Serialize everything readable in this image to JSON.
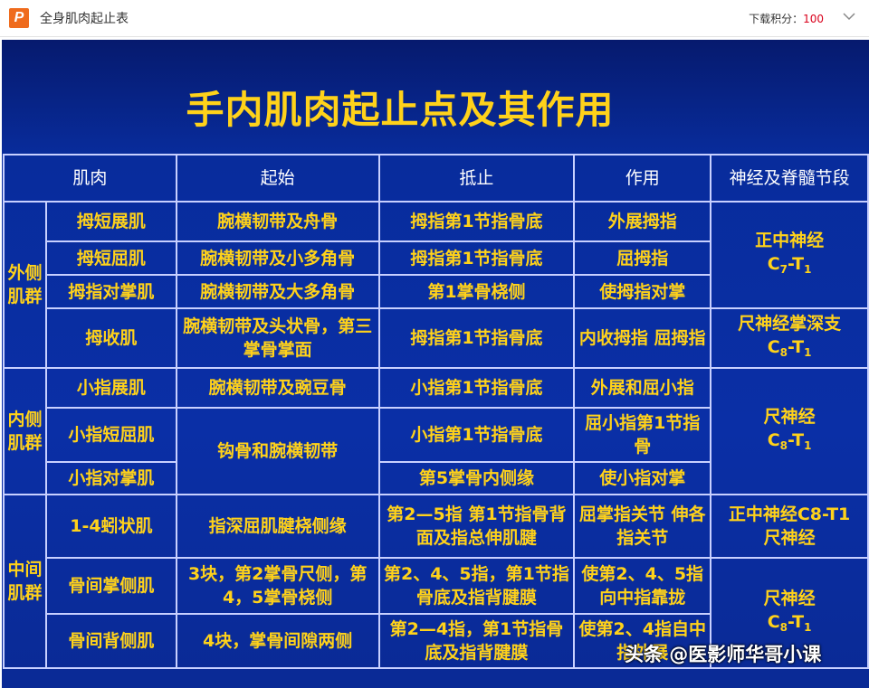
{
  "topbar": {
    "title": "全身肌肉起止表",
    "score_label": "下载积分：",
    "score_value": "100"
  },
  "slide": {
    "title": "手内肌肉起止点及其作用",
    "headers": [
      "肌肉",
      "起始",
      "抵止",
      "作用",
      "神经及脊髓节段"
    ],
    "groups": {
      "lateral": "外侧肌群",
      "medial": "内侧肌群",
      "middle": "中间肌群"
    },
    "rows": [
      {
        "muscle": "拇短展肌",
        "origin": "腕横韧带及舟骨",
        "insertion": "拇指第1节指骨底",
        "action": "外展拇指"
      },
      {
        "muscle": "拇短屈肌",
        "origin": "腕横韧带及小多角骨",
        "insertion": "拇指第1节指骨底",
        "action": "屈拇指"
      },
      {
        "muscle": "拇指对掌肌",
        "origin": "腕横韧带及大多角骨",
        "insertion": "第1掌骨桡侧",
        "action": "使拇指对掌"
      },
      {
        "muscle": "拇收肌",
        "origin": "腕横韧带及头状骨，第三掌骨掌面",
        "insertion": "拇指第1节指骨底",
        "action": "内收拇指 屈拇指"
      },
      {
        "muscle": "小指展肌",
        "origin": "腕横韧带及豌豆骨",
        "insertion": "小指第1节指骨底",
        "action": "外展和屈小指"
      },
      {
        "muscle": "小指短屈肌",
        "origin": "钩骨和腕横韧带",
        "insertion": "小指第1节指骨底",
        "action": "屈小指第1节指骨"
      },
      {
        "muscle": "小指对掌肌",
        "insertion": "第5掌骨内侧缘",
        "action": "使小指对掌"
      },
      {
        "muscle": "1-4蚓状肌",
        "origin": "指深屈肌腱桡侧缘",
        "insertion": "第2—5指 第1节指骨背面及指总伸肌腱",
        "action": "屈掌指关节 伸各指关节"
      },
      {
        "muscle": "骨间掌侧肌",
        "origin": "3块，第2掌骨尺侧，第4，5掌骨桡侧",
        "insertion": "第2、4、5指，第1节指骨底及指背腱膜",
        "action": "使第2、4、5指向中指靠拢"
      },
      {
        "muscle": "骨间背侧肌",
        "origin": "4块，掌骨间隙两侧",
        "insertion": "第2—4指，第1节指骨底及指背腱膜",
        "action": "使第2、4指自中指外展"
      }
    ],
    "nerves": {
      "median_1": "正中神经",
      "median_1_seg": "C7-T1",
      "ulnar_deep": "尺神经掌深支",
      "ulnar_deep_seg": "C8-T1",
      "ulnar_1": "尺神经",
      "ulnar_1_seg": "C8-T1",
      "mixed": "正中神经C8-T1",
      "mixed_2": "尺神经",
      "ulnar_2": "尺神经",
      "ulnar_2_seg": "C8-T1"
    }
  },
  "watermark": "头条 @医影师华哥小课",
  "colors": {
    "slide_bg": "#0a2fa6",
    "text_yellow": "#ffd21a",
    "grid": "#c8d0ff"
  }
}
